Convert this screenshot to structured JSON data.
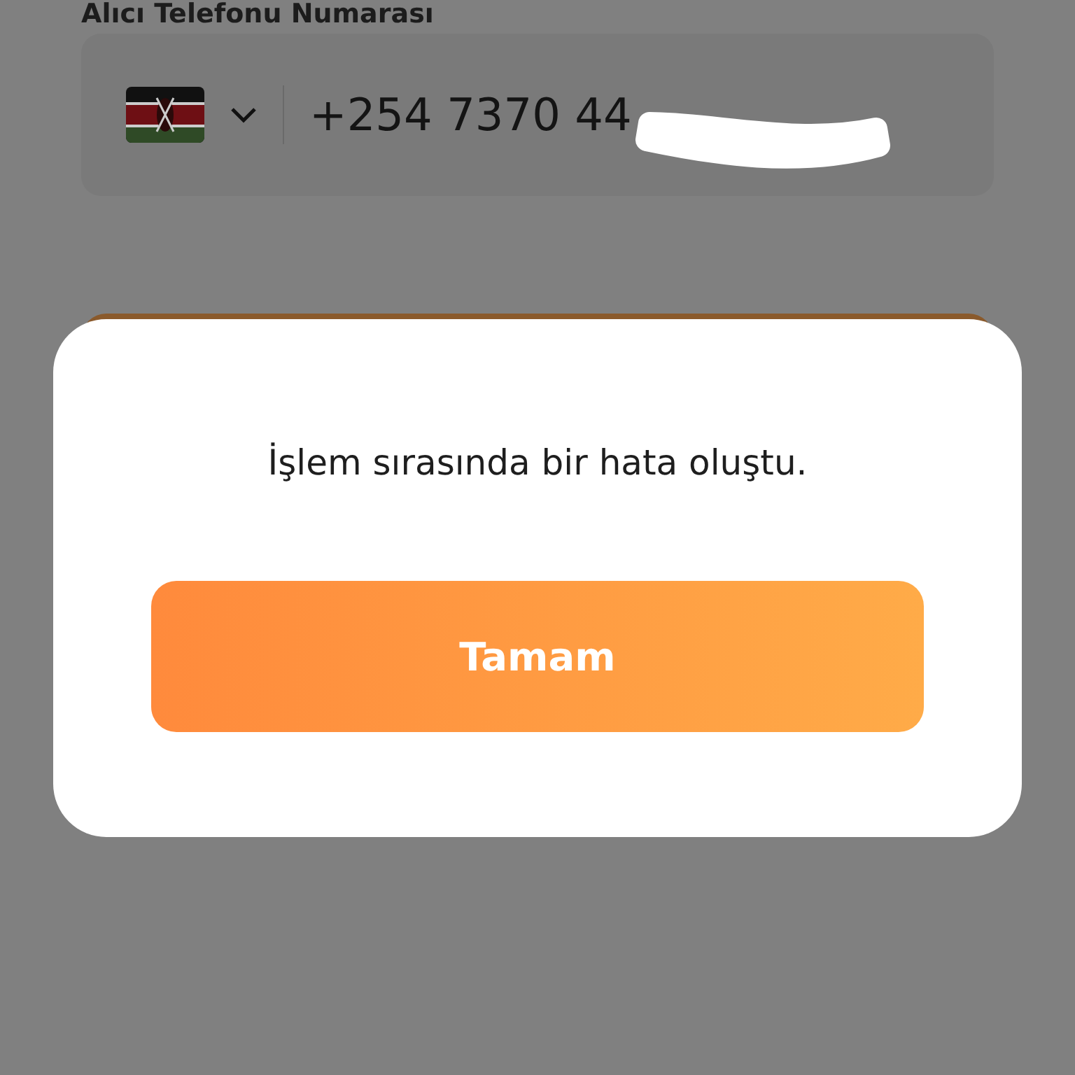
{
  "form": {
    "phone_label": "Alıcı Telefonu Numarası",
    "phone_field": {
      "value": "+254 7370 44"
    }
  },
  "dialog": {
    "message": "İşlem sırasında bir hata oluştu.",
    "button": "Tamam"
  }
}
